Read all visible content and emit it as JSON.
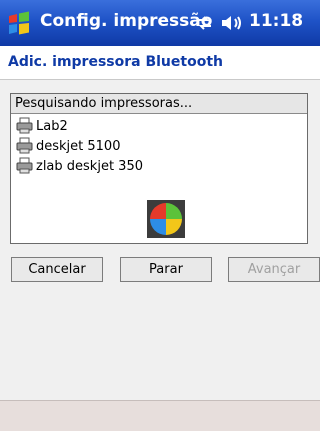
{
  "titlebar": {
    "app_title": "Config. impressão",
    "time": "11:18",
    "icons": [
      "windows-start-icon",
      "connectivity-icon",
      "volume-icon"
    ]
  },
  "screen": {
    "heading": "Adic. impressora Bluetooth"
  },
  "printer_list": {
    "status": "Pesquisando impressoras...",
    "printers": [
      "Lab2",
      "deskjet 5100",
      "zlab deskjet 350"
    ]
  },
  "buttons": {
    "cancel": "Cancelar",
    "stop": "Parar",
    "next": "Avançar"
  },
  "colors": {
    "title_bar": "#1f53c7",
    "heading_text": "#0f3aa6",
    "disabled_text": "#a0a0a0"
  }
}
